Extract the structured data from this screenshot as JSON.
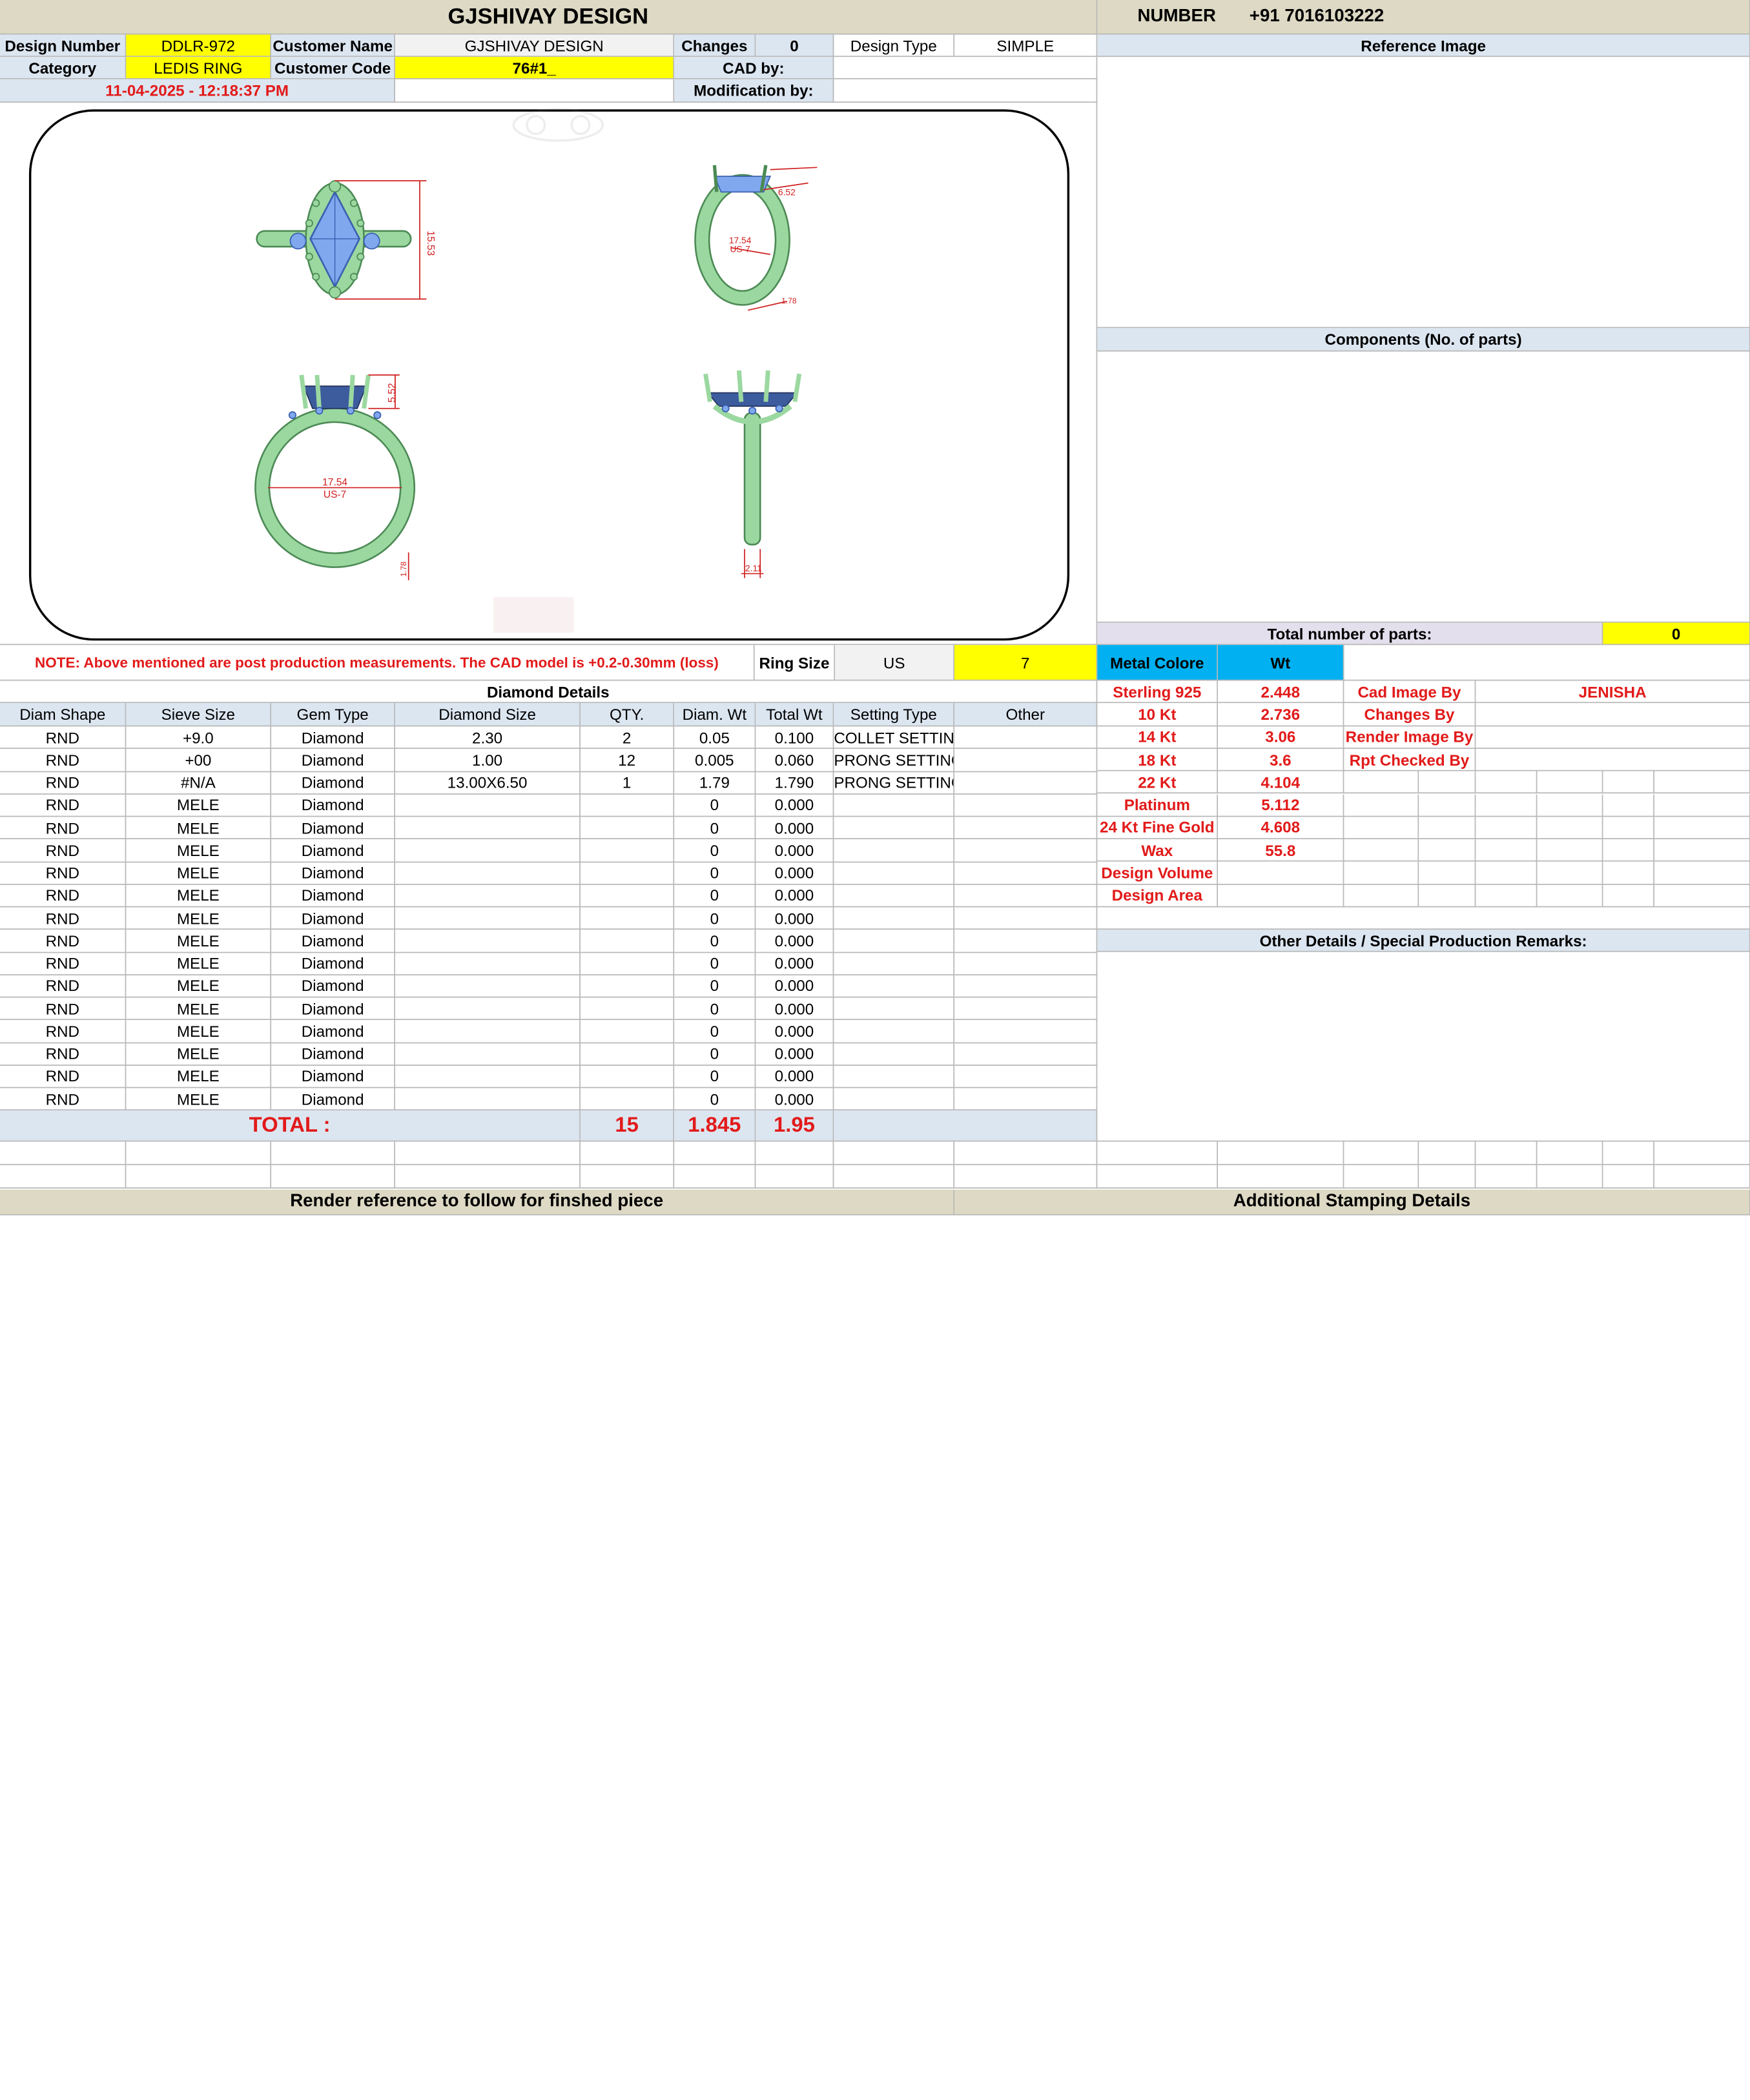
{
  "header": {
    "title": "GJSHIVAY DESIGN",
    "number_label": "NUMBER",
    "number_value": "+91 7016103222"
  },
  "info": {
    "design_number_label": "Design Number",
    "design_number": "DDLR-972",
    "customer_name_label": "Customer Name",
    "customer_name": "GJSHIVAY DESIGN",
    "changes_label": "Changes",
    "changes": "0",
    "design_type_label": "Design Type",
    "design_type": "SIMPLE",
    "category_label": "Category",
    "category": "LEDIS RING",
    "customer_code_label": "Customer Code",
    "customer_code": "76#1_",
    "cad_by_label": "CAD by:",
    "timestamp": "11-04-2025 - 12:18:37 PM",
    "modification_by_label": "Modification by:"
  },
  "right_panel": {
    "reference_image_label": "Reference Image",
    "components_label": "Components (No. of parts)",
    "total_parts_label": "Total number of parts:",
    "total_parts": "0",
    "other_details_label": "Other Details / Special Production Remarks:"
  },
  "drawing": {
    "dims": {
      "top_length": "15.53",
      "side_top": "6.52",
      "side_ring": "17.54",
      "side_ring_us": "US-7",
      "side_band": "1.78",
      "front_height": "5.52",
      "front_ring": "17.54",
      "front_ring_us": "US-7",
      "front_band": "1.78",
      "profile_width": "2.11"
    },
    "colors": {
      "metal": "#9bd8a0",
      "metal_dark": "#4c8a55",
      "stone": "#7fa8ee",
      "stone_dark": "#3a5fb0",
      "dim_line": "#d12020"
    }
  },
  "note": {
    "text": "NOTE: Above mentioned are post production measurements. The CAD model is +0.2-0.30mm (loss)",
    "ring_size_label": "Ring Size",
    "ring_size_unit": "US",
    "ring_size_value": "7"
  },
  "diamond": {
    "title": "Diamond Details",
    "headers": [
      "Diam Shape",
      "Sieve Size",
      "Gem Type",
      "Diamond Size",
      "QTY.",
      "Diam. Wt",
      "Total Wt",
      "Setting Type",
      "Other"
    ],
    "rows": [
      [
        "RND",
        "+9.0",
        "Diamond",
        "2.30",
        "2",
        "0.05",
        "0.100",
        "COLLET SETTING",
        ""
      ],
      [
        "RND",
        "+00",
        "Diamond",
        "1.00",
        "12",
        "0.005",
        "0.060",
        "PRONG SETTING",
        ""
      ],
      [
        "RND",
        "#N/A",
        "Diamond",
        "13.00X6.50",
        "1",
        "1.79",
        "1.790",
        "PRONG SETTING",
        ""
      ],
      [
        "RND",
        "MELE",
        "Diamond",
        "",
        "",
        "0",
        "0.000",
        "",
        ""
      ],
      [
        "RND",
        "MELE",
        "Diamond",
        "",
        "",
        "0",
        "0.000",
        "",
        ""
      ],
      [
        "RND",
        "MELE",
        "Diamond",
        "",
        "",
        "0",
        "0.000",
        "",
        ""
      ],
      [
        "RND",
        "MELE",
        "Diamond",
        "",
        "",
        "0",
        "0.000",
        "",
        ""
      ],
      [
        "RND",
        "MELE",
        "Diamond",
        "",
        "",
        "0",
        "0.000",
        "",
        ""
      ],
      [
        "RND",
        "MELE",
        "Diamond",
        "",
        "",
        "0",
        "0.000",
        "",
        ""
      ],
      [
        "RND",
        "MELE",
        "Diamond",
        "",
        "",
        "0",
        "0.000",
        "",
        ""
      ],
      [
        "RND",
        "MELE",
        "Diamond",
        "",
        "",
        "0",
        "0.000",
        "",
        ""
      ],
      [
        "RND",
        "MELE",
        "Diamond",
        "",
        "",
        "0",
        "0.000",
        "",
        ""
      ],
      [
        "RND",
        "MELE",
        "Diamond",
        "",
        "",
        "0",
        "0.000",
        "",
        ""
      ],
      [
        "RND",
        "MELE",
        "Diamond",
        "",
        "",
        "0",
        "0.000",
        "",
        ""
      ],
      [
        "RND",
        "MELE",
        "Diamond",
        "",
        "",
        "0",
        "0.000",
        "",
        ""
      ],
      [
        "RND",
        "MELE",
        "Diamond",
        "",
        "",
        "0",
        "0.000",
        "",
        ""
      ],
      [
        "RND",
        "MELE",
        "Diamond",
        "",
        "",
        "0",
        "0.000",
        "",
        ""
      ]
    ],
    "total_label": "TOTAL :",
    "total_qty": "15",
    "total_diam_wt": "1.845",
    "total_wt": "1.95"
  },
  "metal": {
    "color_label": "Metal Colore",
    "wt_label": "Wt",
    "rows": [
      {
        "name": "Sterling 925",
        "wt": "2.448",
        "role": "Cad Image By",
        "person": "JENISHA"
      },
      {
        "name": "10 Kt",
        "wt": "2.736",
        "role": "Changes By",
        "person": ""
      },
      {
        "name": "14 Kt",
        "wt": "3.06",
        "role": "Render Image By",
        "person": ""
      },
      {
        "name": "18 Kt",
        "wt": "3.6",
        "role": "Rpt Checked By",
        "person": ""
      },
      {
        "name": "22 Kt",
        "wt": "4.104",
        "role": "",
        "person": ""
      },
      {
        "name": "Platinum",
        "wt": "5.112",
        "role": "",
        "person": ""
      },
      {
        "name": "24 Kt Fine Gold",
        "wt": "4.608",
        "role": "",
        "person": ""
      },
      {
        "name": "Wax",
        "wt": "55.8",
        "role": "",
        "person": ""
      },
      {
        "name": "Design Volume",
        "wt": "",
        "role": "",
        "person": ""
      },
      {
        "name": "Design Area",
        "wt": "",
        "role": "",
        "person": ""
      }
    ]
  },
  "footer": {
    "render_reference": "Render reference to follow for finshed piece",
    "additional_stamping": "Additional Stamping Details"
  }
}
